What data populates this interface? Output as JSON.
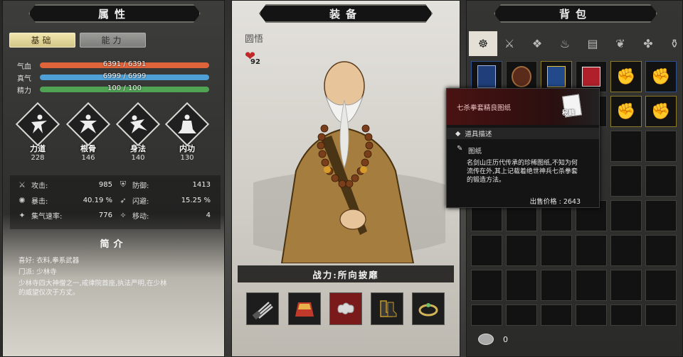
{
  "panels": {
    "attributes_title": "属性",
    "equipment_title": "装备",
    "backpack_title": "背包"
  },
  "attr_tabs": {
    "basic": "基础",
    "ability": "能力"
  },
  "bars": [
    {
      "label": "气血",
      "text": "6391 / 6391",
      "fill": 1.0,
      "color": "#e0643a"
    },
    {
      "label": "真气",
      "text": "6999 / 6999",
      "fill": 1.0,
      "color": "#4fa0d6"
    },
    {
      "label": "精力",
      "text": "100 / 100",
      "fill": 1.0,
      "color": "#4fa353"
    }
  ],
  "skills": [
    {
      "name": "力道",
      "value": "228"
    },
    {
      "name": "根骨",
      "value": "146"
    },
    {
      "name": "身法",
      "value": "140"
    },
    {
      "name": "内功",
      "value": "130"
    }
  ],
  "stats": [
    {
      "label": "攻击:",
      "value": "985",
      "icon": "sword-icon"
    },
    {
      "label": "防御:",
      "value": "1413",
      "icon": "shield-icon"
    },
    {
      "label": "暴击:",
      "value": "40.19 %",
      "icon": "crit-icon"
    },
    {
      "label": "闪避:",
      "value": "15.25 %",
      "icon": "dodge-icon"
    },
    {
      "label": "集气速率:",
      "value": "776",
      "icon": "qi-icon"
    },
    {
      "label": "移动:",
      "value": "4",
      "icon": "move-icon"
    }
  ],
  "intro": {
    "title": "简介",
    "hobby": "喜好: 衣料,拳系武器",
    "sect": "门派: 少林寺",
    "desc_1": "少林寺四大神僧之一,戒律院首座,执法严明,在少林",
    "desc_2": "的威望仅次于方丈。"
  },
  "character": {
    "name": "圆悟",
    "favor": "92",
    "power": "战力:所向披靡"
  },
  "equipment_slots": [
    "claw-weapon-icon",
    "robe-armor-icon",
    "cloud-charm-icon",
    "boots-icon",
    "ring-icon"
  ],
  "bag_tabs": [
    "all-icon",
    "weapon-icon",
    "armor-icon",
    "accessory-icon",
    "book-icon",
    "herb-icon",
    "material-icon",
    "misc-icon"
  ],
  "bag_items_row1": [
    "blue-book-icon",
    "jar-icon",
    "ointment-icon",
    "red-gift-icon",
    "gauntlet-icon",
    "gauntlet-icon"
  ],
  "bag_items_row2": [
    "gauntlet-icon",
    "gauntlet-icon"
  ],
  "money": "0",
  "tooltip": {
    "item_name": "七杀拳套精良图纸",
    "badge": "秘籍",
    "section": "道具描述",
    "type": "图纸",
    "desc": "名剑山庄历代传承的珍稀图纸,不知为何流传在外,其上记载着绝世神兵七杀拳套的锻造方法。",
    "price": "出售价格 : 2643"
  },
  "colors": {
    "accent_gold": "#d4c688",
    "health": "#e0643a",
    "qi": "#4fa0d6",
    "stamina": "#4fa353"
  }
}
